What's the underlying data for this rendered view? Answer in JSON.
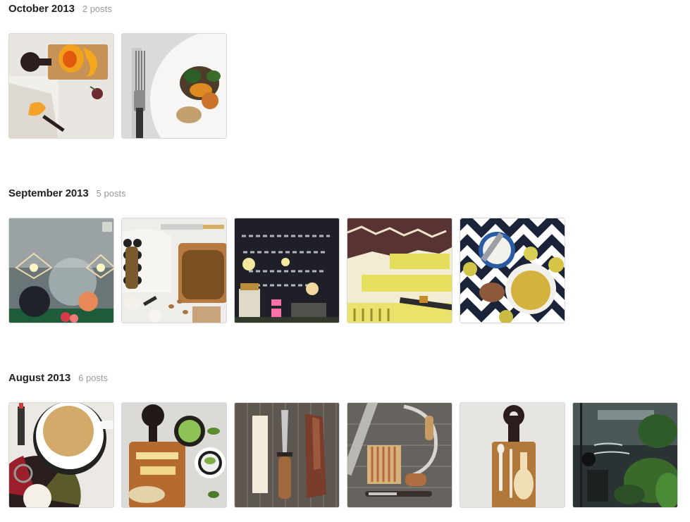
{
  "archive": {
    "months": [
      {
        "title": "October 2013",
        "count": "2 posts",
        "posts": [
          {
            "name": "pumpkin-cutting-board-photo",
            "scene": "pumpkin-board"
          },
          {
            "name": "fork-salad-plate-photo",
            "scene": "fork-plate"
          }
        ]
      },
      {
        "title": "September 2013",
        "count": "5 posts",
        "posts": [
          {
            "name": "window-display-lamps-photo",
            "scene": "window-display"
          },
          {
            "name": "bread-board-almonds-photo",
            "scene": "bread-board"
          },
          {
            "name": "chalkboard-saturday-window-photo",
            "scene": "chalkboard"
          },
          {
            "name": "yellow-poster-print-photo",
            "scene": "yellow-poster"
          },
          {
            "name": "zigzag-bowl-soup-photo",
            "scene": "zigzag-bowls"
          }
        ]
      },
      {
        "title": "August 2013",
        "count": "6 posts",
        "posts": [
          {
            "name": "coffee-cup-top-view-photo",
            "scene": "coffee-cup"
          },
          {
            "name": "cutting-board-snacks-photo",
            "scene": "snack-board"
          },
          {
            "name": "knife-sheath-wood-photo",
            "scene": "knife-sheath"
          },
          {
            "name": "carving-tools-drill-photo",
            "scene": "tools"
          },
          {
            "name": "board-with-spoons-photo",
            "scene": "spoon-board"
          },
          {
            "name": "cafe-window-plants-photo",
            "scene": "cafe-window"
          }
        ]
      }
    ]
  }
}
